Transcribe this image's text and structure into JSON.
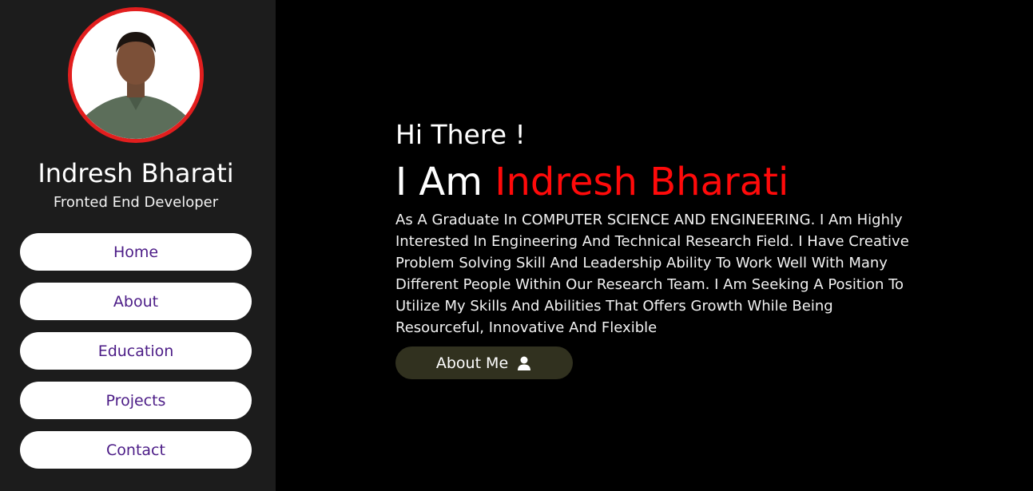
{
  "sidebar": {
    "name": "Indresh Bharati",
    "role": "Fronted End Developer",
    "nav": [
      {
        "label": "Home"
      },
      {
        "label": "About"
      },
      {
        "label": "Education"
      },
      {
        "label": "Projects"
      },
      {
        "label": "Contact"
      }
    ]
  },
  "hero": {
    "greeting": "Hi There !",
    "intro_prefix": "I Am",
    "intro_name": "Indresh Bharati",
    "bio": "As A Graduate In COMPUTER SCIENCE AND ENGINEERING. I Am Highly Interested In Engineering And Technical Research Field. I Have Creative Problem Solving Skill And Leadership Ability To Work Well With Many Different People Within Our Research Team. I Am Seeking A Position To Utilize My Skills And Abilities That Offers Growth While Being Resourceful, Innovative And Flexible",
    "button_label": "About Me",
    "button_icon": "user-icon"
  },
  "colors": {
    "accent": "#ff0a0a",
    "avatar_ring": "#e21e1e",
    "sidebar_bg": "#1c1c1c",
    "page_bg": "#000000",
    "nav_text": "#4b1b86",
    "button_bg": "#31311f"
  }
}
